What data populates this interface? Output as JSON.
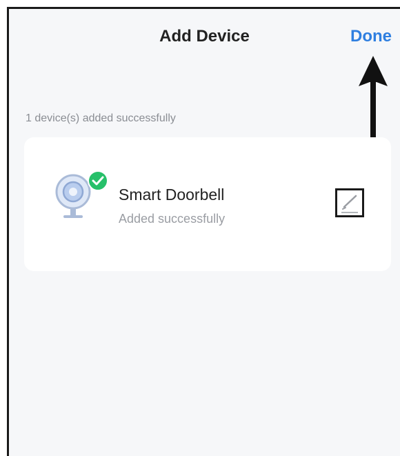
{
  "header": {
    "title": "Add Device",
    "done_label": "Done"
  },
  "status_message": "1 device(s) added successfully",
  "devices": [
    {
      "name": "Smart Doorbell",
      "status": "Added successfully",
      "icon": "camera-icon",
      "badge_icon": "check-icon",
      "edit_icon": "pencil-icon"
    }
  ],
  "colors": {
    "accent": "#2f7fe0",
    "success": "#27c06a",
    "background": "#f6f7f9",
    "card": "#ffffff"
  }
}
